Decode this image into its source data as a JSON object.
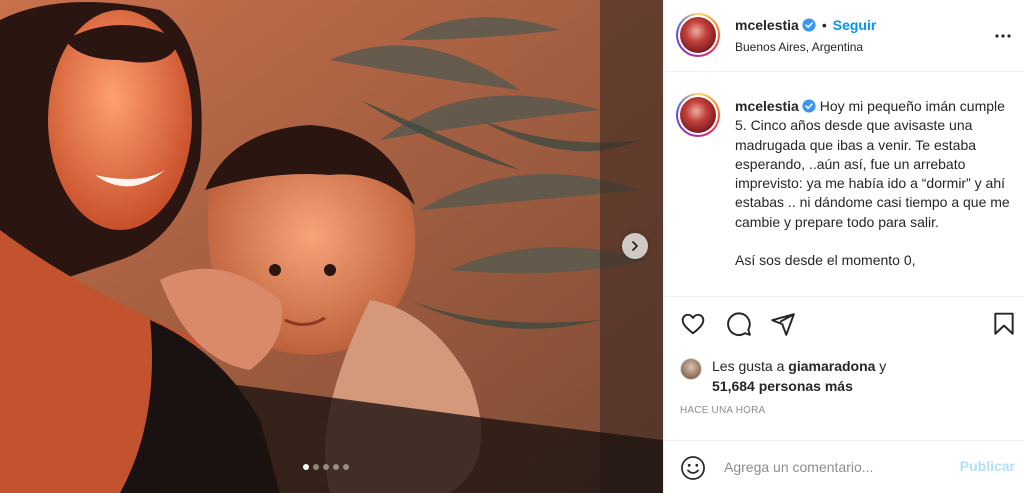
{
  "post": {
    "photo_alt": "",
    "carousel": {
      "total": 5,
      "active_index": 0
    }
  },
  "header": {
    "username": "mcelestia",
    "separator": "•",
    "follow_label": "Seguir",
    "location": "Buenos Aires, Argentina"
  },
  "caption": {
    "username": "mcelestia",
    "text": "Hoy mi pequeño imán cumple 5. Cinco años desde que avisaste una madrugada que ibas a venir. Te estaba esperando, ..aún así, fue un arrebato imprevisto: ya me había ido a “dormir” y ahí estabas .. ni dándome casi tiempo a que me cambie y prepare todo para salir.\n\nAsí sos desde el momento 0,"
  },
  "likes": {
    "prefix": "Les gusta a ",
    "liker": "giamaradona",
    "joiner": " y",
    "others": "51,684 personas más"
  },
  "timestamp": "HACE UNA HORA",
  "comment": {
    "placeholder": "Agrega un comentario...",
    "publish_label": "Publicar"
  },
  "colors": {
    "accent": "#0095f6",
    "publish_disabled": "#b2dffc",
    "muted": "#8e8e8e"
  },
  "icons": [
    "more-options-icon",
    "heart-icon",
    "comment-icon",
    "share-icon",
    "bookmark-icon",
    "emoji-icon",
    "verified-badge-icon",
    "chevron-right-icon"
  ]
}
